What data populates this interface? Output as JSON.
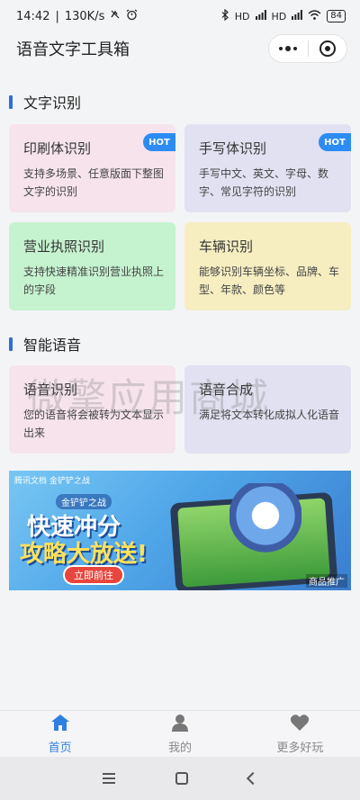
{
  "status_bar": {
    "time": "14:42",
    "network_speed": "130K/s",
    "signal_1": "HD",
    "signal_2": "HD",
    "battery": "84"
  },
  "app": {
    "title": "语音文字工具箱"
  },
  "sections": [
    {
      "title": "文字识别",
      "cards": [
        {
          "title": "印刷体识别",
          "desc": "支持多场景、任意版面下整图文字的识别",
          "badge": "HOT",
          "color": "#f6e3ec"
        },
        {
          "title": "手写体识别",
          "desc": "手写中文、英文、字母、数字、常见字符的识别",
          "badge": "HOT",
          "color": "#e1e1f2"
        },
        {
          "title": "营业执照识别",
          "desc": "支持快速精准识别营业执照上的字段",
          "color": "#c5f2cf"
        },
        {
          "title": "车辆识别",
          "desc": "能够识别车辆坐标、品牌、车型、年款、颜色等",
          "color": "#f6eec1"
        }
      ]
    },
    {
      "title": "智能语音",
      "cards": [
        {
          "title": "语音识别",
          "desc": "您的语音将会被转为文本显示出来",
          "color": "#f6e3ec"
        },
        {
          "title": "语音合成",
          "desc": "满足将文本转化成拟人化语音",
          "color": "#e1e1f2"
        }
      ]
    }
  ],
  "watermark": "微擎应用商城",
  "banner": {
    "brand": "腾讯文档 金铲铲之战",
    "subtitle": "金铲铲之战",
    "line1": "快速冲分",
    "line2": "攻略大放送!",
    "button": "立即前往",
    "ad_tag": "商品推广"
  },
  "tabbar": {
    "items": [
      {
        "label": "首页",
        "icon": "home-icon",
        "active": true
      },
      {
        "label": "我的",
        "icon": "user-icon"
      },
      {
        "label": "更多好玩",
        "icon": "heart-icon"
      }
    ],
    "active_color": "#2f7fe0"
  },
  "colors": {
    "accent": "#2f6dd9",
    "hot_badge": "#2c8cf4"
  }
}
